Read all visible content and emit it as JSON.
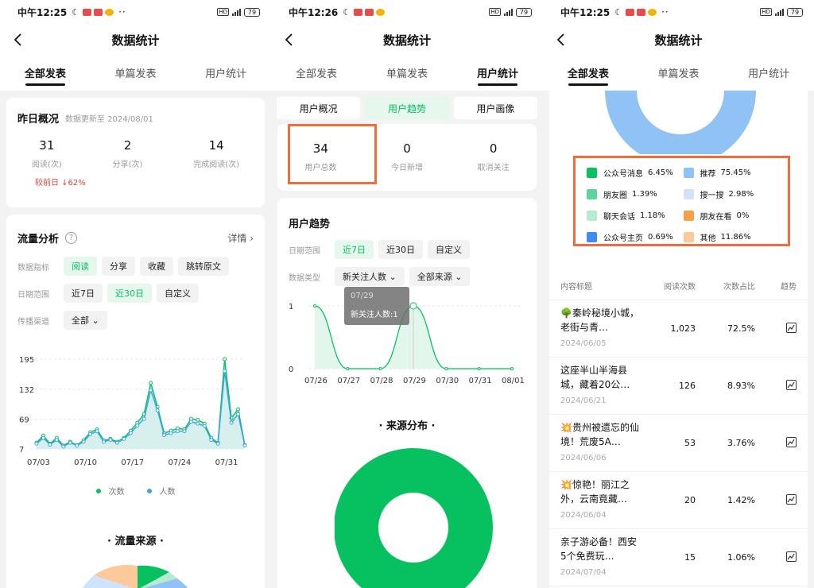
{
  "status1": {
    "time": "中午12:25",
    "battery": "79"
  },
  "status2": {
    "time": "中午12:26",
    "battery": "79"
  },
  "status3": {
    "time": "中午12:25",
    "battery": "79"
  },
  "title": "数据统计",
  "tabs": [
    "全部发表",
    "单篇发表",
    "用户统计"
  ],
  "screen1": {
    "overview": {
      "title": "昨日概况",
      "updated": "数据更新至 2024/08/01",
      "stats": [
        {
          "value": "31",
          "label": "阅读(次)"
        },
        {
          "value": "2",
          "label": "分享(次)"
        },
        {
          "value": "14",
          "label": "完成阅读(次)"
        }
      ],
      "compare": "较前日 ↓62%"
    },
    "traffic": {
      "title": "流量分析",
      "help": "?",
      "detail": "详情 ›",
      "metric_label": "数据指标",
      "metrics": [
        "阅读",
        "分享",
        "收藏",
        "跳转原文"
      ],
      "date_label": "日期范围",
      "dates": [
        "近7日",
        "近30日",
        "自定义"
      ],
      "channel_label": "传播渠道",
      "channel": "全部"
    },
    "source_title": "· 流量来源 ·"
  },
  "screen2": {
    "subtabs": [
      "用户概况",
      "用户趋势",
      "用户画像"
    ],
    "stats": [
      {
        "value": "34",
        "label": "用户总数"
      },
      {
        "value": "0",
        "label": "今日新增"
      },
      {
        "value": "0",
        "label": "取消关注"
      }
    ],
    "trend": {
      "title": "用户趋势",
      "date_label": "日期范围",
      "dates": [
        "近7日",
        "近30日",
        "自定义"
      ],
      "type_label": "数据类型",
      "type": "新关注人数",
      "source": "全部来源",
      "tooltip_date": "07/29",
      "tooltip_value": "新关注人数:1"
    },
    "source_title": "· 来源分布 ·"
  },
  "screen3": {
    "legend": [
      {
        "name": "公众号消息",
        "pct": "6.45%",
        "color": "#07c160"
      },
      {
        "name": "推荐",
        "pct": "75.45%",
        "color": "#90c2f6"
      },
      {
        "name": "朋友圈",
        "pct": "1.39%",
        "color": "#5dd39e"
      },
      {
        "name": "搜一搜",
        "pct": "2.98%",
        "color": "#cfe3fa"
      },
      {
        "name": "聊天会话",
        "pct": "1.18%",
        "color": "#b6ead1"
      },
      {
        "name": "朋友在看",
        "pct": "0%",
        "color": "#f7a04b"
      },
      {
        "name": "公众号主页",
        "pct": "0.69%",
        "color": "#3e8cf0"
      },
      {
        "name": "其他",
        "pct": "11.86%",
        "color": "#fcc99a"
      }
    ],
    "table_headers": [
      "内容标题",
      "阅读次数",
      "次数占比",
      "趋势"
    ],
    "rows": [
      {
        "title": "🌳秦岭秘境小城，老街与青…",
        "date": "2024/06/05",
        "reads": "1,023",
        "share": "72.5%"
      },
      {
        "title": "这座半山半海县城，藏着20公…",
        "date": "2024/06/21",
        "reads": "126",
        "share": "8.93%"
      },
      {
        "title": "💥贵州被遗忘的仙境！荒废5A…",
        "date": "2024/06/06",
        "reads": "53",
        "share": "3.76%"
      },
      {
        "title": "💥惊艳！丽江之外，云南竟藏…",
        "date": "2024/06/04",
        "reads": "20",
        "share": "1.42%"
      },
      {
        "title": "亲子游必备！西安5个免费玩…",
        "date": "2024/07/04",
        "reads": "15",
        "share": "1.06%"
      }
    ]
  },
  "chart_data": [
    {
      "type": "line",
      "title": "",
      "x_ticks": [
        "07/03",
        "07/10",
        "07/17",
        "07/24",
        "07/31"
      ],
      "y_ticks": [
        "195",
        "132",
        "69",
        "7"
      ],
      "ylim": [
        7,
        195
      ],
      "series": [
        {
          "name": "次数",
          "color": "#07c160",
          "values": [
            20,
            35,
            18,
            30,
            14,
            22,
            15,
            25,
            42,
            48,
            25,
            28,
            22,
            30,
            45,
            62,
            80,
            145,
            95,
            40,
            45,
            50,
            48,
            70,
            68,
            60,
            30,
            20,
            195,
            72,
            90,
            15
          ]
        },
        {
          "name": "人数",
          "color": "#3ea6e6",
          "values": [
            18,
            30,
            16,
            26,
            12,
            20,
            14,
            22,
            38,
            44,
            22,
            26,
            20,
            28,
            40,
            56,
            70,
            130,
            88,
            36,
            40,
            44,
            44,
            64,
            60,
            55,
            26,
            18,
            170,
            62,
            80,
            14
          ]
        }
      ]
    },
    {
      "type": "line",
      "title": "",
      "x_ticks": [
        "07/26",
        "07/27",
        "07/28",
        "07/29",
        "07/30",
        "07/31",
        "08/01"
      ],
      "y_ticks": [
        "1",
        "0"
      ],
      "ylim": [
        0,
        1
      ],
      "series": [
        {
          "name": "新关注人数",
          "values": [
            1,
            0,
            0,
            1,
            0,
            0,
            0
          ]
        }
      ]
    },
    {
      "type": "pie",
      "title": "",
      "series": [
        {
          "name": "",
          "values": [
            100
          ]
        }
      ]
    }
  ]
}
